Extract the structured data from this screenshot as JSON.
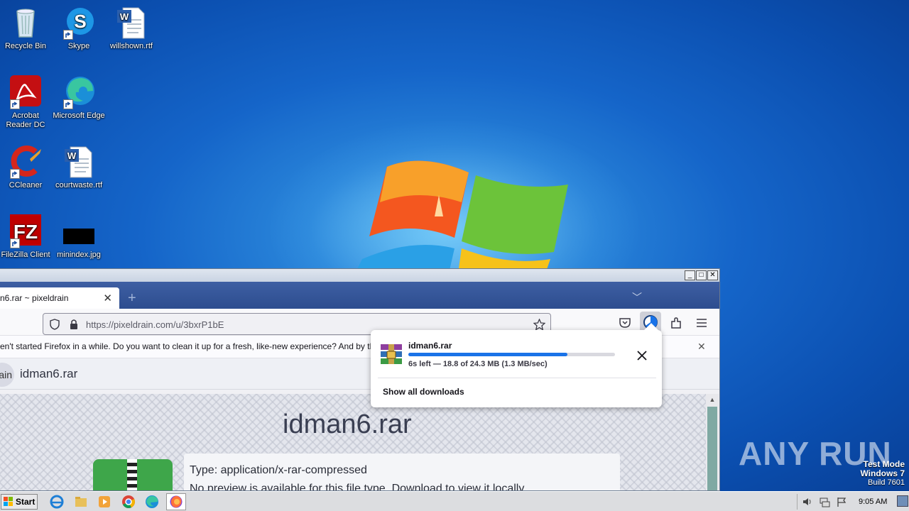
{
  "desktop": {
    "icons": [
      {
        "label": "Recycle Bin"
      },
      {
        "label": "Skype"
      },
      {
        "label": "willshown.rtf"
      },
      {
        "label": "Acrobat Reader DC"
      },
      {
        "label": "Microsoft Edge"
      },
      {
        "label": "CCleaner"
      },
      {
        "label": "courtwaste.rtf"
      },
      {
        "label": "FileZilla Client"
      },
      {
        "label": "minindex.jpg"
      }
    ]
  },
  "watermark": {
    "brand": "ANY RUN",
    "mode": "Test Mode",
    "os": "Windows 7",
    "build": "Build 7601"
  },
  "browser": {
    "tab_title": "n6.rar ~ pixeldrain",
    "new_tab": "+",
    "url": "https://pixeldrain.com/u/3bxrP1bE",
    "notification": "en't started Firefox in a while. Do you want to clean it up for a fresh, like-new experience? And by the way, we",
    "page_header_logo": "ain",
    "page_header_name": "idman6.rar",
    "page_title": "idman6.rar",
    "file_type": "Type: application/x-rar-compressed",
    "no_preview": "No preview is available for this file type. Download to view it locally."
  },
  "downloads_panel": {
    "file_name": "idman6.rar",
    "progress": 0.77,
    "status": "6s left — 18.8 of 24.3 MB (1.3 MB/sec)",
    "show_all": "Show all downloads",
    "progress_color": "#1a73e8"
  },
  "taskbar": {
    "start_label": "Start",
    "clock": "9:05 AM"
  }
}
